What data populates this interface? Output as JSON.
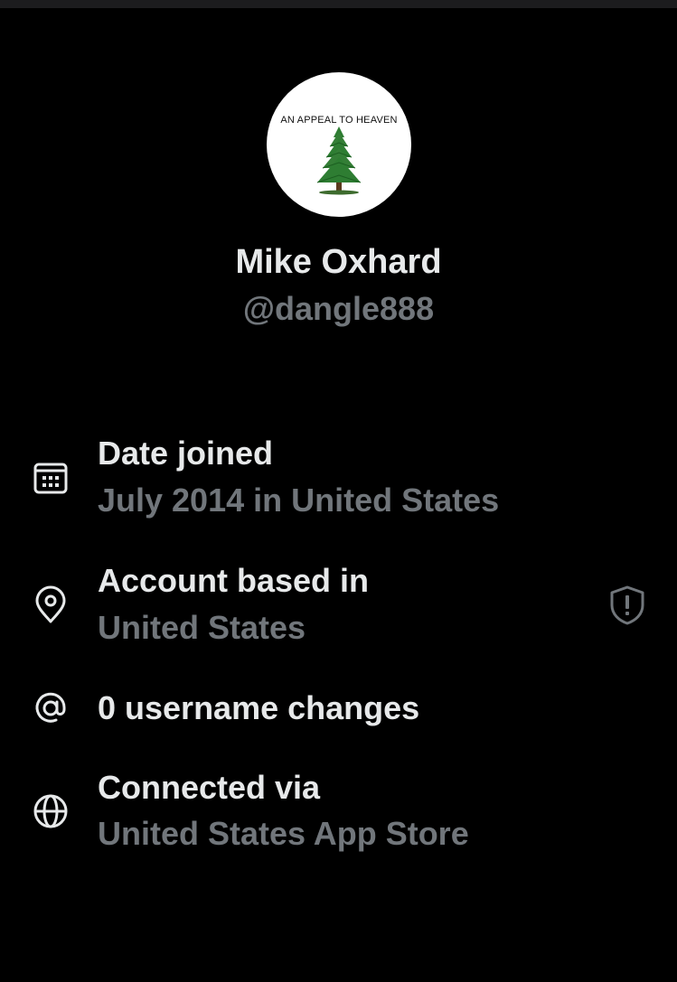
{
  "profile": {
    "avatar_caption": "AN APPEAL TO HEAVEN",
    "display_name": "Mike Oxhard",
    "handle": "@dangle888"
  },
  "about": {
    "date_joined": {
      "icon": "calendar-icon",
      "title": "Date joined",
      "value": "July 2014 in United States"
    },
    "account_based": {
      "icon": "location-pin-icon",
      "title": "Account based in",
      "value": "United States",
      "action_icon": "shield-alert-icon"
    },
    "username_changes": {
      "icon": "at-sign-icon",
      "title": "0 username changes"
    },
    "connected_via": {
      "icon": "globe-icon",
      "title": "Connected via",
      "value": "United States App Store"
    }
  },
  "colors": {
    "background": "#000000",
    "primary_text": "#e7e9ea",
    "secondary_text": "#71767b",
    "tree_green": "#2e7d32"
  }
}
